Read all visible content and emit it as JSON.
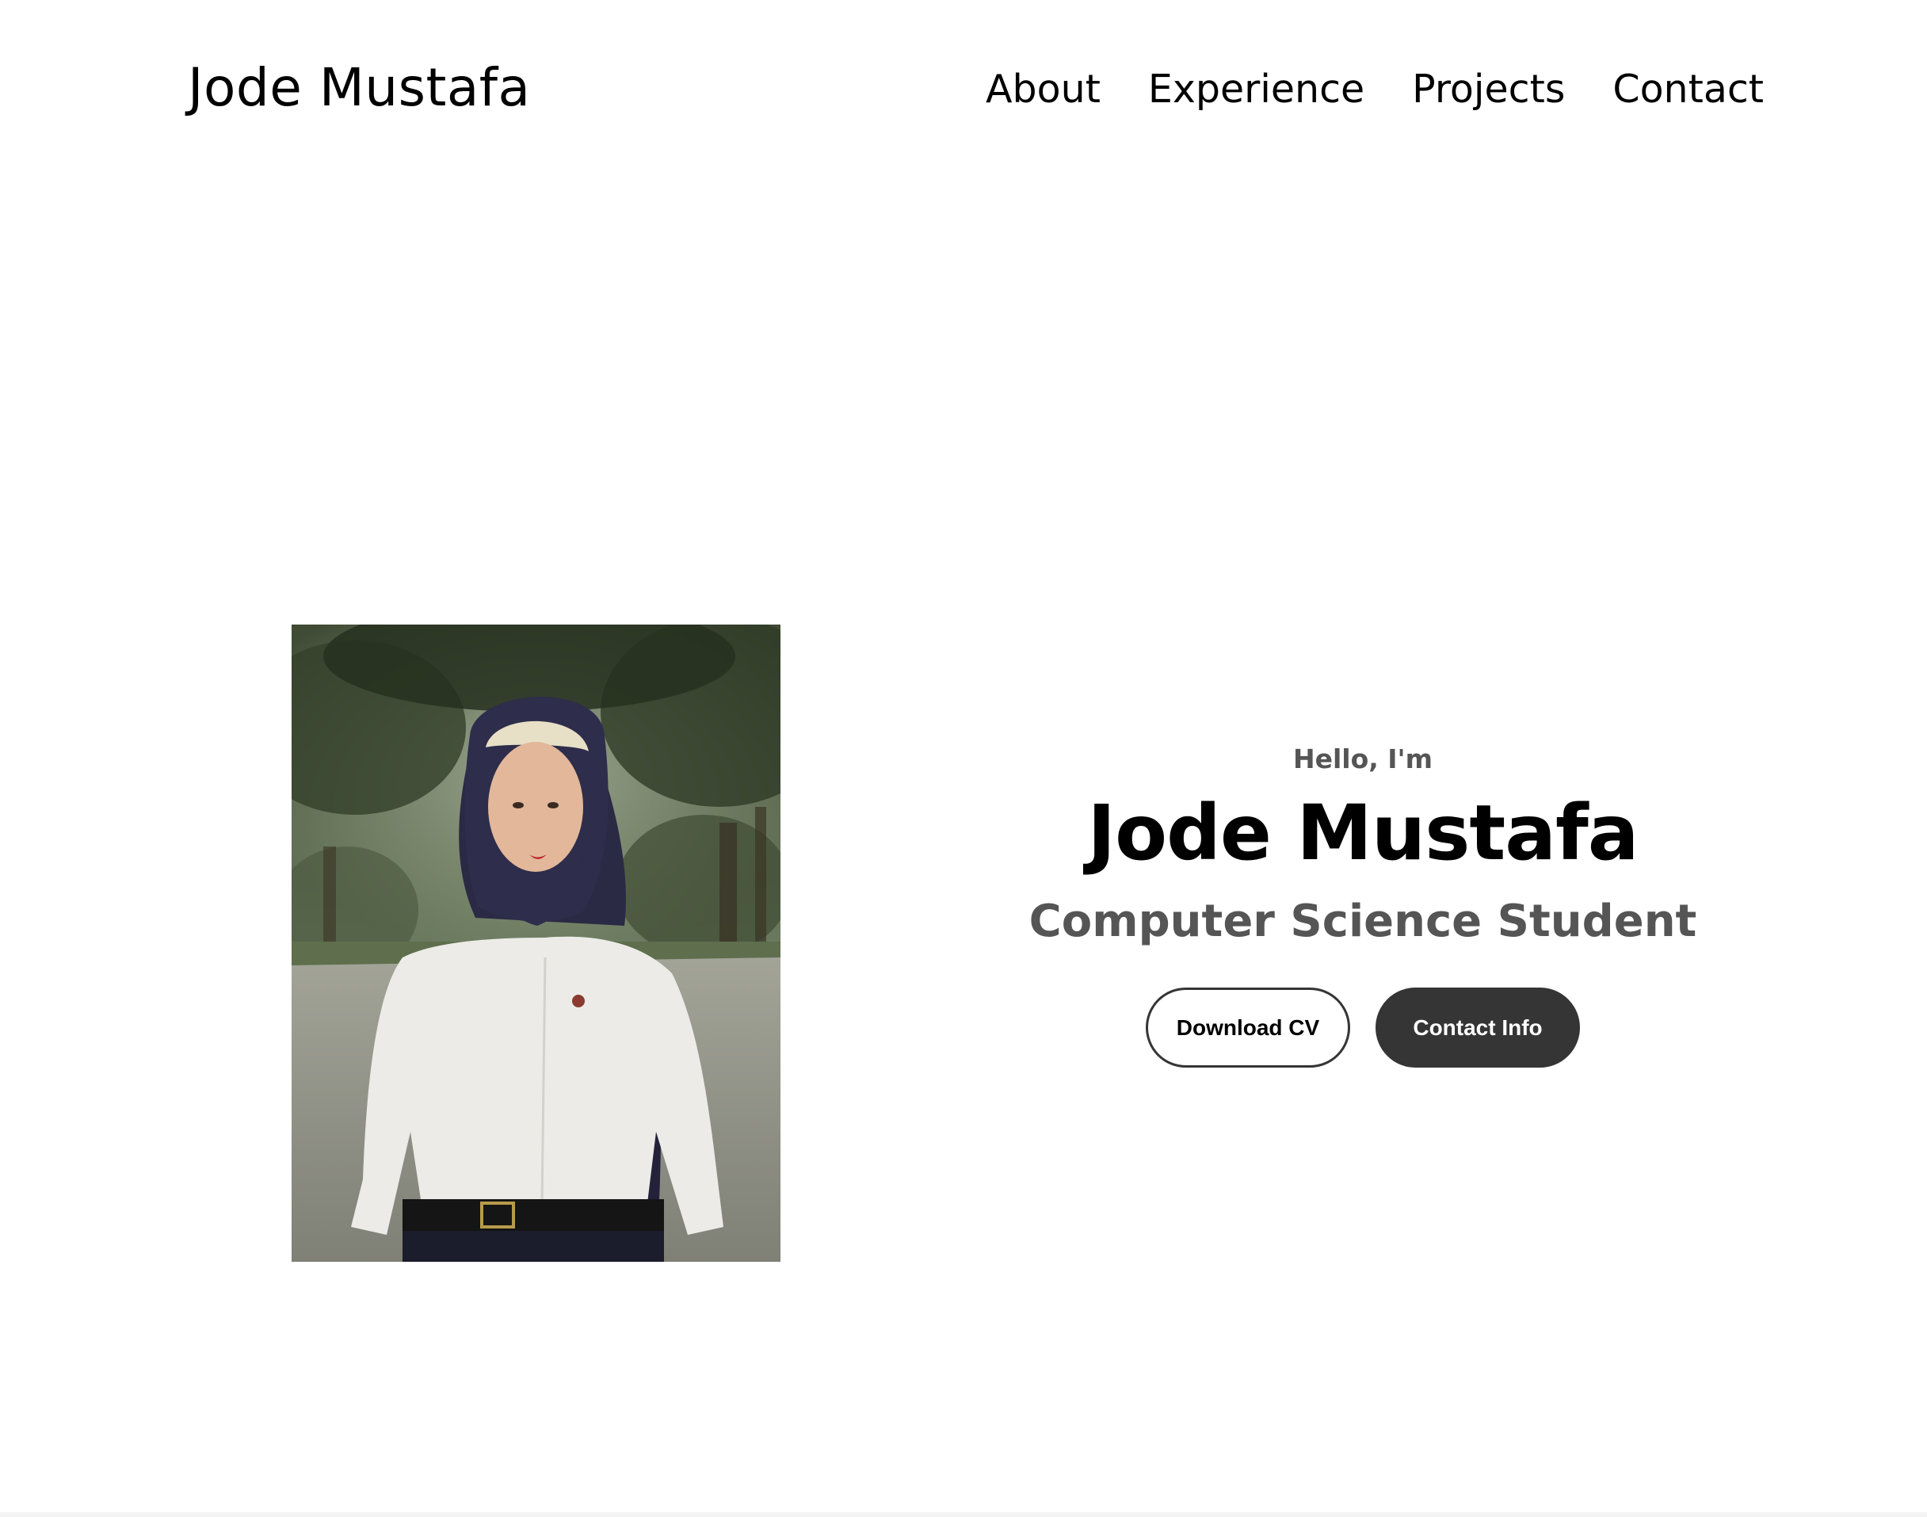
{
  "header": {
    "logo_text": "Jode Mustafa",
    "nav": [
      {
        "label": "About"
      },
      {
        "label": "Experience"
      },
      {
        "label": "Projects"
      },
      {
        "label": "Contact"
      }
    ]
  },
  "hero": {
    "image_name": "profile-photo",
    "greeting": "Hello, I'm",
    "name": "Jode Mustafa",
    "role": "Computer Science Student",
    "buttons": {
      "download_cv": "Download CV",
      "contact_info": "Contact Info"
    }
  },
  "colors": {
    "background": "#ffffff",
    "text_primary": "#000000",
    "text_secondary": "#555555",
    "button_dark": "#353535"
  }
}
